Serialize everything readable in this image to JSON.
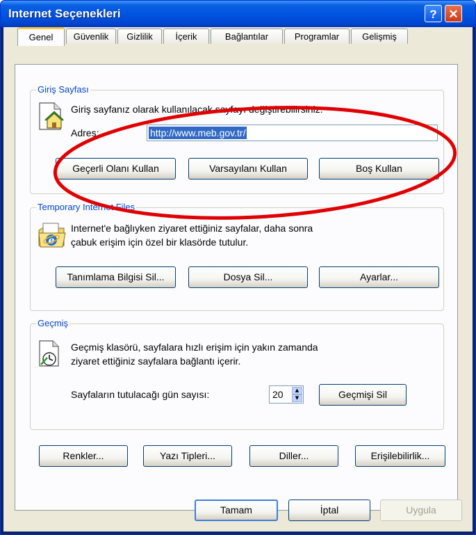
{
  "window": {
    "title": "Internet Seçenekleri",
    "help_button": "?",
    "close_button": "✕"
  },
  "tabs": [
    {
      "label": "Genel",
      "active": true
    },
    {
      "label": "Güvenlik"
    },
    {
      "label": "Gizlilik"
    },
    {
      "label": "İçerik"
    },
    {
      "label": "Bağlantılar"
    },
    {
      "label": "Programlar"
    },
    {
      "label": "Gelişmiş"
    }
  ],
  "home_page": {
    "legend": "Giriş Sayfası",
    "description": "Giriş sayfanız olarak kullanılacak sayfayı değiştirebilirsiniz.",
    "address_label": "Adres:",
    "address_value": "http://www.meb.gov.tr/",
    "buttons": {
      "use_current": "Geçerli Olanı Kullan",
      "use_default": "Varsayılanı Kullan",
      "use_blank": "Boş Kullan"
    }
  },
  "temp_files": {
    "legend": "Temporary Internet Files",
    "description_line1": "Internet'e bağlıyken ziyaret ettiğiniz sayfalar, daha sonra",
    "description_line2": "çabuk erişim için özel bir klasörde tutulur.",
    "buttons": {
      "delete_cookies": "Tanımlama Bilgisi Sil...",
      "delete_files": "Dosya Sil...",
      "settings": "Ayarlar..."
    }
  },
  "history": {
    "legend": "Geçmiş",
    "description_line1": "Geçmiş klasörü, sayfalara hızlı erişim için yakın zamanda",
    "description_line2": "ziyaret ettiğiniz sayfalara bağlantı içerir.",
    "days_label": "Sayfaların tutulacağı gün sayısı:",
    "days_value": "20",
    "clear_button": "Geçmişi Sil"
  },
  "bottom_buttons": {
    "colors": "Renkler...",
    "fonts": "Yazı Tipleri...",
    "languages": "Diller...",
    "accessibility": "Erişilebilirlik..."
  },
  "dialog_buttons": {
    "ok": "Tamam",
    "cancel": "İptal",
    "apply": "Uygula"
  },
  "colors": {
    "titlebar": "#0054e3",
    "client": "#ece9d8",
    "legend_text": "#0046d5",
    "selection": "#316ac5",
    "annotation": "#e00000"
  }
}
